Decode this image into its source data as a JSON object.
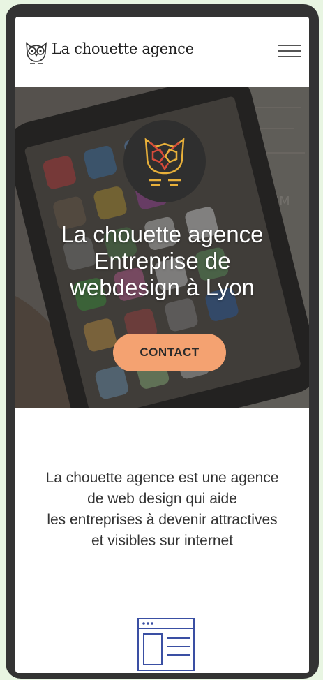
{
  "header": {
    "brand_name": "La chouette agence",
    "logo_icon": "owl-logo-icon",
    "menu_icon": "hamburger-menu-icon"
  },
  "hero": {
    "emblem_icon": "owl-emblem-icon",
    "title_line1": "La chouette agence",
    "title_line2": "Entreprise de",
    "title_line3": "webdesign à Lyon",
    "contact_label": "CONTACT",
    "bg_handwriting": "SISM"
  },
  "intro": {
    "line1": "La chouette agence est une agence",
    "line2": "de web design qui aide",
    "line3": "les entreprises à devenir attractives",
    "line4": "et visibles sur internet"
  },
  "features": {
    "icon": "webpage-layout-icon"
  },
  "colors": {
    "accent": "#f4a271",
    "phone_frame": "#333333",
    "page_background": "#e8f5e2",
    "icon_blue": "#3a4fa3",
    "emblem_orange": "#e8b03a",
    "emblem_red": "#d84b3a"
  }
}
